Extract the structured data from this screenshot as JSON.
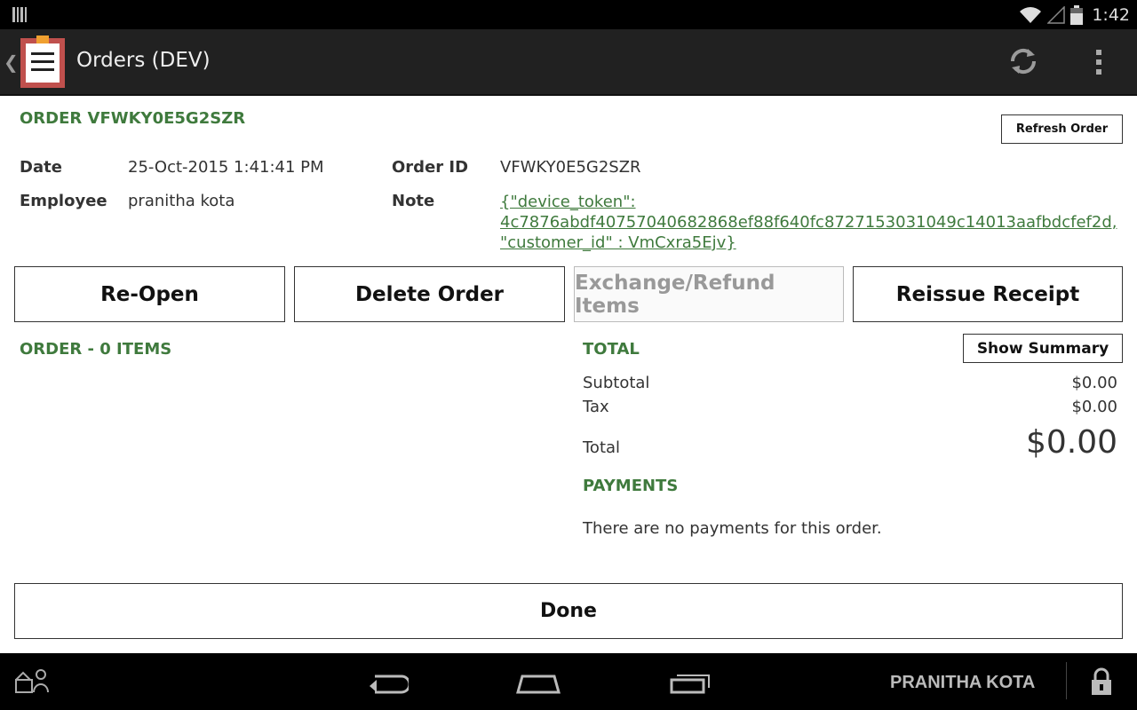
{
  "status_bar": {
    "time": "1:42"
  },
  "action_bar": {
    "title": "Orders (DEV)"
  },
  "order": {
    "heading": "ORDER VFWKY0E5G2SZR",
    "refresh_label": "Refresh Order",
    "date_label": "Date",
    "date_value": "25-Oct-2015 1:41:41 PM",
    "employee_label": "Employee",
    "employee_value": "pranitha kota",
    "order_id_label": "Order ID",
    "order_id_value": "VFWKY0E5G2SZR",
    "note_label": "Note",
    "note_line1": "{\"device_token\":",
    "note_line2": "4c7876abdf40757040682868ef88f640fc8727153031049c14013aafbdcfef2d,",
    "note_line3": "\"customer_id\" : VmCxra5Ejv}"
  },
  "actions": {
    "reopen": "Re-Open",
    "delete": "Delete Order",
    "exchange": "Exchange/Refund Items",
    "reissue": "Reissue Receipt"
  },
  "items": {
    "heading": "ORDER - 0 ITEMS"
  },
  "totals": {
    "heading": "TOTAL",
    "show_summary": "Show Summary",
    "subtotal_label": "Subtotal",
    "subtotal_value": "$0.00",
    "tax_label": "Tax",
    "tax_value": "$0.00",
    "total_label": "Total",
    "total_value": "$0.00"
  },
  "payments": {
    "heading": "PAYMENTS",
    "empty_text": "There are no payments for this order."
  },
  "done_label": "Done",
  "nav_bar": {
    "user_name": "PRANITHA KOTA"
  },
  "colors": {
    "accent_green": "#3f7a3d",
    "bar_dark": "#212121"
  }
}
